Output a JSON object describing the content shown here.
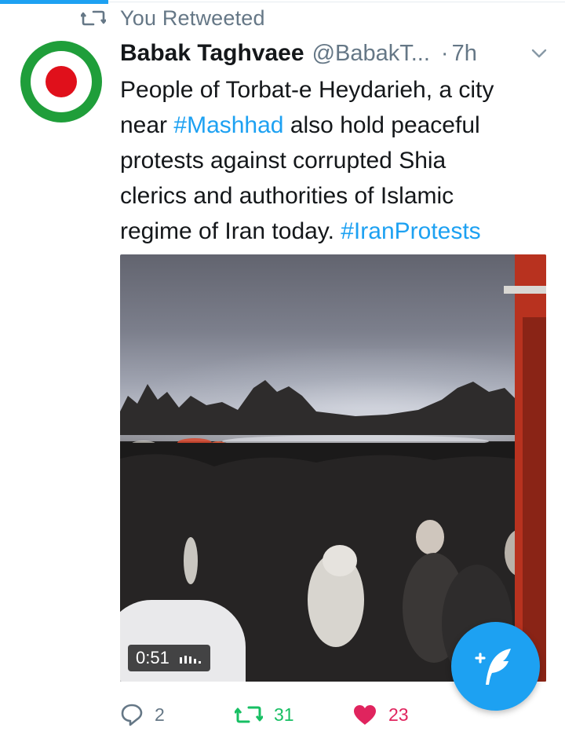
{
  "colors": {
    "accent": "#1da1f2",
    "retweet_green": "#17bf63",
    "like_red": "#e0245e",
    "muted": "#657786",
    "avatar_green": "#1f9e3a",
    "avatar_red": "#e0101b"
  },
  "social_context": {
    "icon": "retweet-icon",
    "label": "You Retweeted"
  },
  "tweet": {
    "author": {
      "name": "Babak Taghvaee",
      "handle": "@BabakT...",
      "avatar_icon": "avatar-iran-roundel"
    },
    "separator": "·",
    "time": "7h",
    "menu_icon": "chevron-down-icon",
    "text_lines": {
      "line1": "People of Torbat-e Heydarieh, a city",
      "line2_prefix": "near ",
      "line2_hashtag": "#Mashhad",
      "line2_suffix": " also hold peaceful",
      "line3": "protests against corrupted Shia",
      "line4": "clerics and authorities of Islamic",
      "line5_prefix": "regime of Iran today. ",
      "line5_hashtag": "#IranProtests"
    },
    "media": {
      "type": "video",
      "duration": "0:51",
      "volume_icon": "volume-bars-icon"
    },
    "actions": {
      "reply": {
        "icon": "reply-icon",
        "count": "2"
      },
      "retweet": {
        "icon": "retweet-icon",
        "count": "31",
        "active": true
      },
      "like": {
        "icon": "heart-icon",
        "count": "23",
        "active": true
      }
    }
  },
  "fab": {
    "icon": "compose-tweet-icon"
  }
}
